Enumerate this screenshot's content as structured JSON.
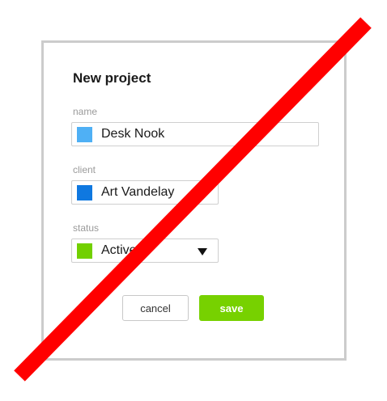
{
  "dialog": {
    "title": "New project",
    "fields": {
      "name": {
        "label": "name",
        "value": "Desk Nook",
        "color": "#4fb0f5"
      },
      "client": {
        "label": "client",
        "value": "Art Vandelay",
        "color": "#0f78e0"
      },
      "status": {
        "label": "status",
        "value": "Active",
        "color": "#72d000"
      }
    },
    "buttons": {
      "cancel_label": "cancel",
      "save_label": "save"
    }
  },
  "overlay": {
    "icon": "prohibited-slash",
    "color": "#ff0000"
  }
}
